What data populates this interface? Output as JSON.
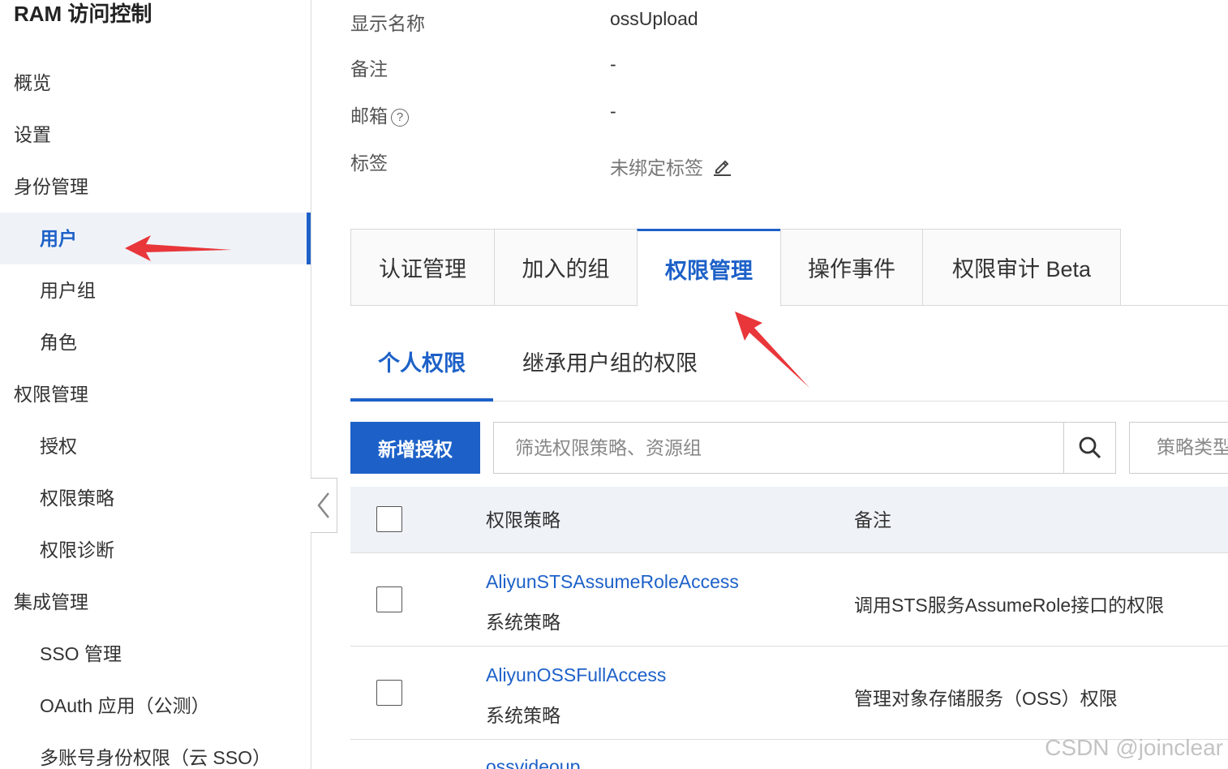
{
  "sidebar": {
    "brand": "RAM 访问控制",
    "items": [
      {
        "label": "概览"
      },
      {
        "label": "设置"
      },
      {
        "label": "身份管理"
      },
      {
        "label": "用户"
      },
      {
        "label": "用户组"
      },
      {
        "label": "角色"
      },
      {
        "label": "权限管理"
      },
      {
        "label": "授权"
      },
      {
        "label": "权限策略"
      },
      {
        "label": "权限诊断"
      },
      {
        "label": "集成管理"
      },
      {
        "label": "SSO 管理"
      },
      {
        "label": "OAuth 应用（公测）"
      },
      {
        "label": "多账号身份权限（云 SSO）"
      }
    ]
  },
  "details": {
    "display_name_label": "显示名称",
    "display_name_value": "ossUpload",
    "note_label": "备注",
    "note_value": "-",
    "email_label": "邮箱",
    "email_value": "-",
    "tags_label": "标签",
    "tags_value": "未绑定标签"
  },
  "tabs": [
    {
      "label": "认证管理"
    },
    {
      "label": "加入的组"
    },
    {
      "label": "权限管理"
    },
    {
      "label": "操作事件"
    },
    {
      "label": "权限审计 Beta"
    }
  ],
  "subtabs": [
    {
      "label": "个人权限"
    },
    {
      "label": "继承用户组的权限"
    }
  ],
  "toolbar": {
    "add_label": "新增授权",
    "search_placeholder": "筛选权限策略、资源组",
    "type_select": "策略类型"
  },
  "table": {
    "headers": {
      "policy": "权限策略",
      "note": "备注"
    },
    "rows": [
      {
        "name": "AliyunSTSAssumeRoleAccess",
        "type": "系统策略",
        "note": "调用STS服务AssumeRole接口的权限"
      },
      {
        "name": "AliyunOSSFullAccess",
        "type": "系统策略",
        "note": "管理对象存储服务（OSS）权限"
      },
      {
        "name": "ossvideoup"
      }
    ]
  },
  "watermark": "CSDN @joinclear",
  "colors": {
    "accent": "#1d61c8",
    "annotation": "#e8363a"
  },
  "selection": {
    "active_tab": "权限管理",
    "active_subtab": "个人权限",
    "active_nav": "用户"
  }
}
